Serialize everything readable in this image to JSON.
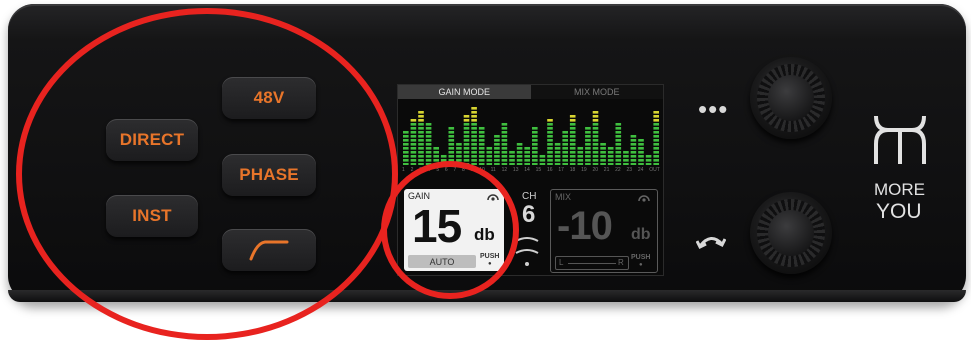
{
  "buttons": {
    "v48": "48V",
    "direct": "DIRECT",
    "phase": "PHASE",
    "inst": "INST"
  },
  "icons": {
    "dots": "more-dots-icon",
    "highpass": "high-pass-filter-icon",
    "rotate": "rotate-arrow-icon",
    "logo": "more-you-logo"
  },
  "screen": {
    "tabs": {
      "gain_mode": "GAIN MODE",
      "mix_mode": "MIX MODE"
    },
    "channels": [
      "1",
      "2",
      "3",
      "4",
      "5",
      "6",
      "7",
      "8",
      "9",
      "10",
      "11",
      "12",
      "13",
      "14",
      "15",
      "16",
      "17",
      "18",
      "19",
      "20",
      "21",
      "22",
      "23",
      "24",
      "OUT"
    ],
    "gain": {
      "label": "GAIN",
      "value": "15",
      "unit": "db",
      "auto_label": "AUTO",
      "push_label": "PUSH"
    },
    "channel": {
      "label": "CH",
      "value": "6"
    },
    "mix": {
      "label": "MIX",
      "value": "-10",
      "unit": "db",
      "left": "L",
      "right": "R",
      "push_label": "PUSH"
    }
  },
  "brand": {
    "line1": "MORE",
    "line2": "YOU"
  },
  "colors": {
    "accent": "#e8752a",
    "annotation": "#e8231f",
    "meter_green": "#3fbf3f",
    "meter_yellow": "#d7d431"
  }
}
